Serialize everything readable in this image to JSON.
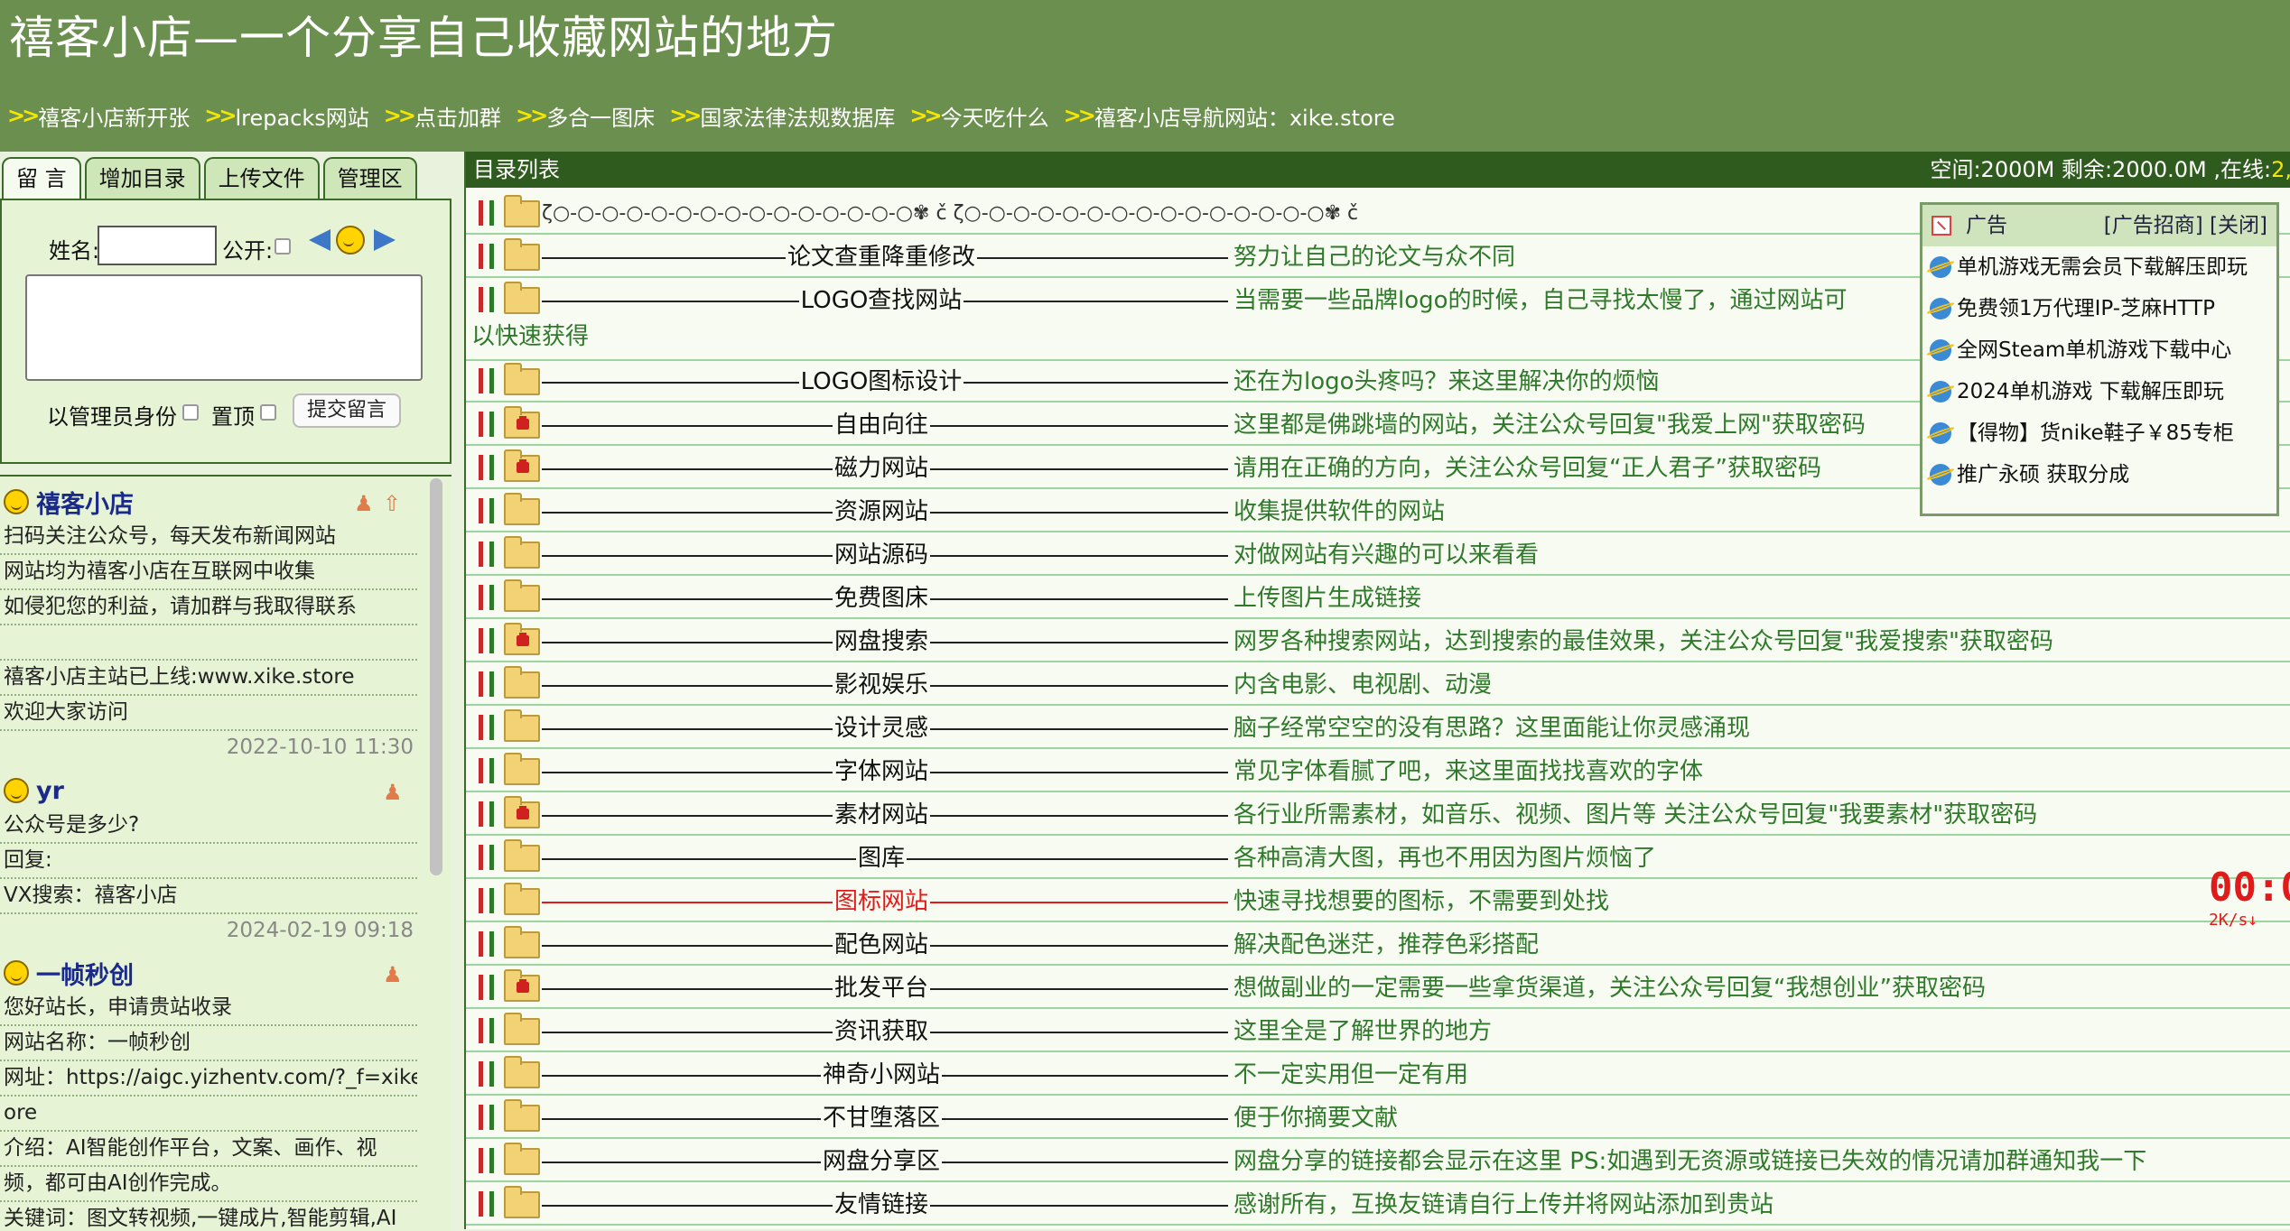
{
  "header": {
    "title": "禧客小店—一个分享自己收藏网站的地方",
    "nav": [
      "禧客小店新开张",
      "lrepacks网站",
      "点击加群",
      "多合一图床",
      "国家法律法规数据库",
      "今天吃什么",
      "禧客小店导航网站：xike.store"
    ]
  },
  "tabs": [
    "留 言",
    "增加目录",
    "上传文件",
    "管理区"
  ],
  "form": {
    "name_label": "姓名:",
    "public_label": "公开:",
    "as_admin_label": "以管理员身份",
    "top_label": "置顶",
    "submit_label": "提交留言"
  },
  "messages": [
    {
      "name": "禧客小店",
      "lines": [
        "扫码关注公众号，每天发布新闻网站",
        "网站均为禧客小店在互联网中收集",
        "如侵犯您的利益，请加群与我取得联系",
        "",
        "禧客小店主站已上线:www.xike.store",
        "欢迎大家访问"
      ],
      "time": "2022-10-10 11:30"
    },
    {
      "name": "yr",
      "lines": [
        "公众号是多少?",
        "回复:",
        "VX搜索：禧客小店"
      ],
      "time": "2024-02-19 09:18"
    },
    {
      "name": "一帧秒创",
      "lines": [
        "您好站长，申请贵站收录",
        "网站名称：一帧秒创",
        "网址：https://aigc.yizhentv.com/?_f=xikest",
        "ore",
        "介绍：AI智能创作平台，文案、画作、视",
        "频，都可由AI创作完成。",
        "关键词：图文转视频,一键成片,智能剪辑,AI"
      ],
      "time": ""
    }
  ],
  "main": {
    "title": "目录列表",
    "stats_prefix": "空间:2000M 剩余:2000.0M ,在线:",
    "stats_online": "2,",
    "decor": "ζ○-○-○-○-○-○-○-○-○-○-○-○-○-○-○✾ č ζ○-○-○-○-○-○-○-○-○-○-○-○-○-○-○✾ č",
    "rows": [
      {
        "cat": "论文查重降重修改",
        "desc": "努力让自己的论文与众不同",
        "lock": false,
        "red": false
      },
      {
        "cat": "LOGO查找网站",
        "desc": "当需要一些品牌logo的时候，自己寻找太慢了，通过网站可",
        "desc2": "以快速获得",
        "lock": false,
        "red": false
      },
      {
        "cat": "LOGO图标设计",
        "desc": "还在为logo头疼吗？来这里解决你的烦恼",
        "lock": false,
        "red": false
      },
      {
        "cat": "自由向往",
        "desc": "这里都是佛跳墙的网站，关注公众号回复\"我爱上网\"获取密码",
        "lock": true,
        "red": false
      },
      {
        "cat": "磁力网站",
        "desc": "请用在正确的方向，关注公众号回复“正人君子”获取密码",
        "lock": true,
        "red": false
      },
      {
        "cat": "资源网站",
        "desc": "收集提供软件的网站",
        "lock": false,
        "red": false
      },
      {
        "cat": "网站源码",
        "desc": "对做网站有兴趣的可以来看看",
        "lock": false,
        "red": false
      },
      {
        "cat": "免费图床",
        "desc": "上传图片生成链接",
        "lock": false,
        "red": false
      },
      {
        "cat": "网盘搜索",
        "desc": "网罗各种搜索网站，达到搜索的最佳效果，关注公众号回复\"我爱搜索\"获取密码",
        "lock": true,
        "red": false
      },
      {
        "cat": "影视娱乐",
        "desc": "内含电影、电视剧、动漫",
        "lock": false,
        "red": false
      },
      {
        "cat": "设计灵感",
        "desc": "脑子经常空空的没有思路？这里面能让你灵感涌现",
        "lock": false,
        "red": false
      },
      {
        "cat": "字体网站",
        "desc": "常见字体看腻了吧，来这里面找找喜欢的字体",
        "lock": false,
        "red": false
      },
      {
        "cat": "素材网站",
        "desc": "各行业所需素材，如音乐、视频、图片等 关注公众号回复\"我要素材\"获取密码",
        "lock": true,
        "red": false
      },
      {
        "cat": "图库",
        "desc": "各种高清大图，再也不用因为图片烦恼了",
        "lock": false,
        "red": false
      },
      {
        "cat": "图标网站",
        "desc": "快速寻找想要的图标，不需要到处找",
        "lock": false,
        "red": true
      },
      {
        "cat": "配色网站",
        "desc": "解决配色迷茫，推荐色彩搭配",
        "lock": false,
        "red": false
      },
      {
        "cat": "批发平台",
        "desc": "想做副业的一定需要一些拿货渠道，关注公众号回复“我想创业”获取密码",
        "lock": true,
        "red": false
      },
      {
        "cat": "资讯获取",
        "desc": "这里全是了解世界的地方",
        "lock": false,
        "red": false
      },
      {
        "cat": "神奇小网站",
        "desc": "不一定实用但一定有用",
        "lock": false,
        "red": false
      },
      {
        "cat": "不甘堕落区",
        "desc": "便于你摘要文献",
        "lock": false,
        "red": false
      },
      {
        "cat": "网盘分享区",
        "desc": "网盘分享的链接都会显示在这里 PS:如遇到无资源或链接已失效的情况请加群通知我一下",
        "lock": false,
        "red": false
      },
      {
        "cat": "友情链接",
        "desc": "感谢所有，互换友链请自行上传并将网站添加到贵站",
        "lock": false,
        "red": false
      }
    ]
  },
  "ad": {
    "title": "广告",
    "right": "[广告招商] [关闭]",
    "items": [
      "单机游戏无需会员下载解压即玩",
      "免费领1万代理IP-芝麻HTTP",
      "全网Steam单机游戏下载中心",
      "2024单机游戏 下载解压即玩",
      "【得物】货nike鞋子￥85专柜",
      "推广永硕 获取分成"
    ]
  },
  "timer": {
    "value": "00:0",
    "speed_a": "2K/s↓",
    "speed_b": "2K"
  },
  "colors": {
    "header_bg": "#6b8f4e",
    "desc_green": "#2f7a2a",
    "active_red": "#e01b1b"
  }
}
